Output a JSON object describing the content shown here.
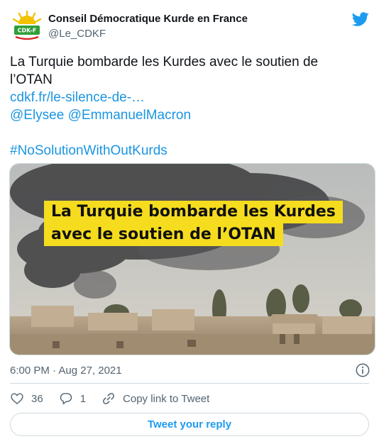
{
  "author": {
    "name": "Conseil Démocratique Kurde en France",
    "handle": "@Le_CDKF",
    "avatar_text": "CDK-F",
    "brand_colors": {
      "sun": "#f2c200",
      "green": "#2f9e3a",
      "red": "#d9252a"
    }
  },
  "platform_icon": "twitter-bird-icon",
  "tweet": {
    "text_line1": "La Turquie bombarde les Kurdes avec le soutien de",
    "text_line2": "l’OTAN",
    "link": "cdkf.fr/le-silence-de-…",
    "mention1": "@Elysee",
    "mention2": "@EmmanuelMacron",
    "hashtag": "#NoSolutionWithOutKurds"
  },
  "media": {
    "headline_line1": "La Turquie bombarde les Kurdes",
    "headline_line2": "avec le soutien de l’OTAN",
    "headline_bg": "#f5dc1e"
  },
  "meta": {
    "timestamp": "6:00 PM · Aug 27, 2021"
  },
  "actions": {
    "likes": "36",
    "replies": "1",
    "copy_label": "Copy link to Tweet",
    "reply_button": "Tweet your reply"
  },
  "colors": {
    "accent": "#1d9bf0",
    "link": "#1b95e0",
    "muted": "#536471",
    "border": "#cfd9de"
  }
}
